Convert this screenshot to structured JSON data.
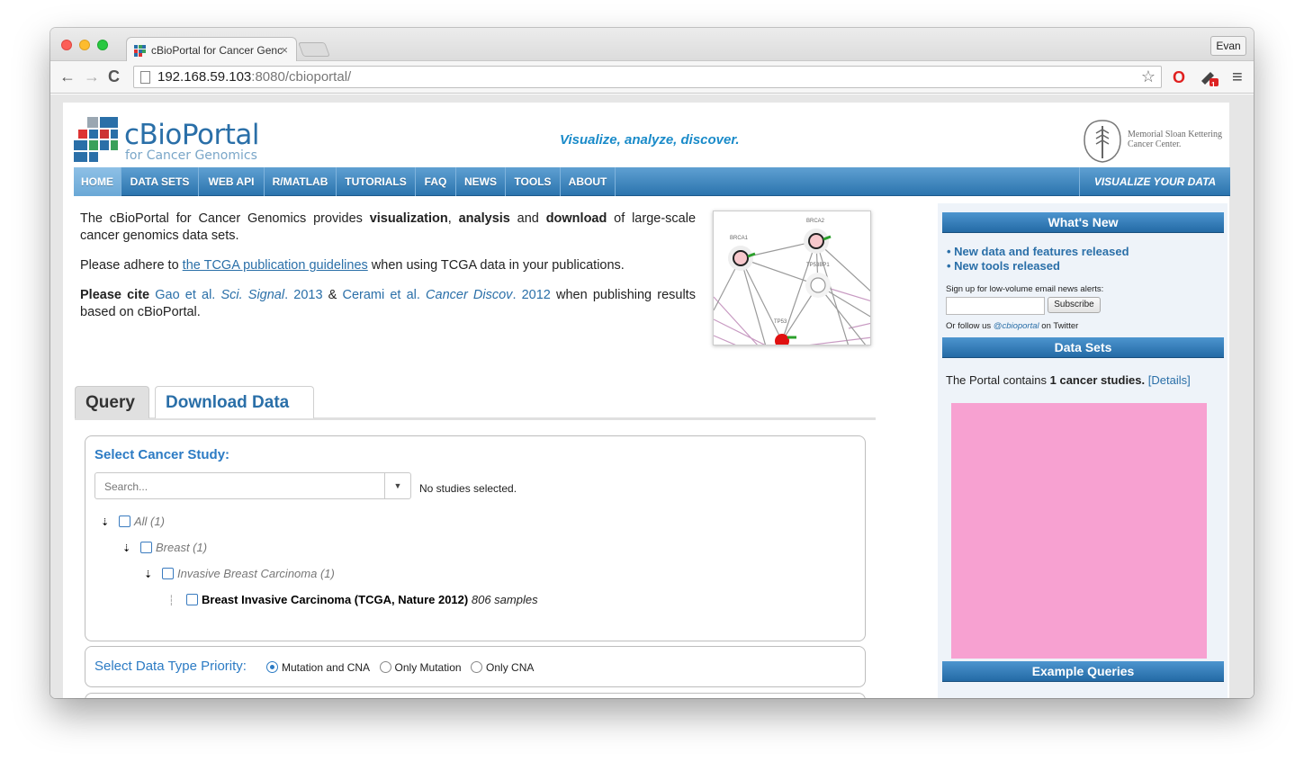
{
  "browser": {
    "tab_title": "cBioPortal for Cancer Genc",
    "tab_close": "×",
    "user_button": "Evan",
    "url_host": "192.168.59.103",
    "url_rest": ":8080/cbioportal/",
    "back_icon": "←",
    "forward_icon": "→",
    "reload_icon": "C",
    "star_icon": "☆",
    "opera_icon": "O",
    "ext_badge": "1",
    "menu_icon": "≡"
  },
  "header": {
    "logo_title": "cBioPortal",
    "logo_subtitle": "for Cancer Genomics",
    "tagline": "Visualize, analyze, discover.",
    "mskcc_line1": "Memorial Sloan Kettering",
    "mskcc_line2": "Cancer Center."
  },
  "menu": {
    "items": [
      "HOME",
      "DATA SETS",
      "WEB API",
      "R/MATLAB",
      "TUTORIALS",
      "FAQ",
      "NEWS",
      "TOOLS",
      "ABOUT"
    ],
    "right": "VISUALIZE YOUR DATA"
  },
  "intro": {
    "p1_a": "The cBioPortal for Cancer Genomics provides ",
    "p1_b": "visualization",
    "p1_c": ", ",
    "p1_d": "analysis",
    "p1_e": " and ",
    "p1_f": "download",
    "p1_g": " of large-scale cancer genomics data sets.",
    "p2_a": "Please adhere to ",
    "p2_link": "the TCGA publication guidelines",
    "p2_b": " when using TCGA data in your publications.",
    "p3_a": "Please cite",
    "p3_link1a": "Gao et al. ",
    "p3_link1b": "Sci. Signal",
    "p3_link1c": ". 2013",
    "p3_amp": " & ",
    "p3_link2a": "Cerami et al. ",
    "p3_link2b": "Cancer Discov",
    "p3_link2c": ". 2012",
    "p3_b": " when publishing results based on cBioPortal."
  },
  "network": {
    "labels": [
      "BRCA1",
      "BRCA2",
      "TP53BP1",
      "TP53"
    ]
  },
  "query_tabs": {
    "query": "Query",
    "download": "Download Data"
  },
  "study": {
    "heading": "Select Cancer Study:",
    "search_placeholder": "Search...",
    "dropdown_caret": "▼",
    "no_selection": "No studies selected.",
    "tree": {
      "all": "All (1)",
      "breast": "Breast (1)",
      "invasive": "Invasive Breast Carcinoma (1)",
      "leaf": "Breast Invasive Carcinoma (TCGA, Nature 2012)",
      "leaf_samples": "806 samples"
    }
  },
  "priority": {
    "heading": "Select Data Type Priority:",
    "options": [
      "Mutation and CNA",
      "Only Mutation",
      "Only CNA"
    ]
  },
  "sidebar": {
    "whats_new": "What's New",
    "news": [
      "• New data and features released",
      "• New tools released"
    ],
    "signup": "Sign up for low-volume email news alerts:",
    "subscribe": "Subscribe",
    "follow_a": "Or follow us ",
    "follow_handle": "@cbioportal",
    "follow_b": " on Twitter",
    "data_sets": "Data Sets",
    "portal_a": "The Portal contains ",
    "portal_b": "1 cancer studies.",
    "details": "[Details]",
    "example_queries": "Example Queries"
  }
}
